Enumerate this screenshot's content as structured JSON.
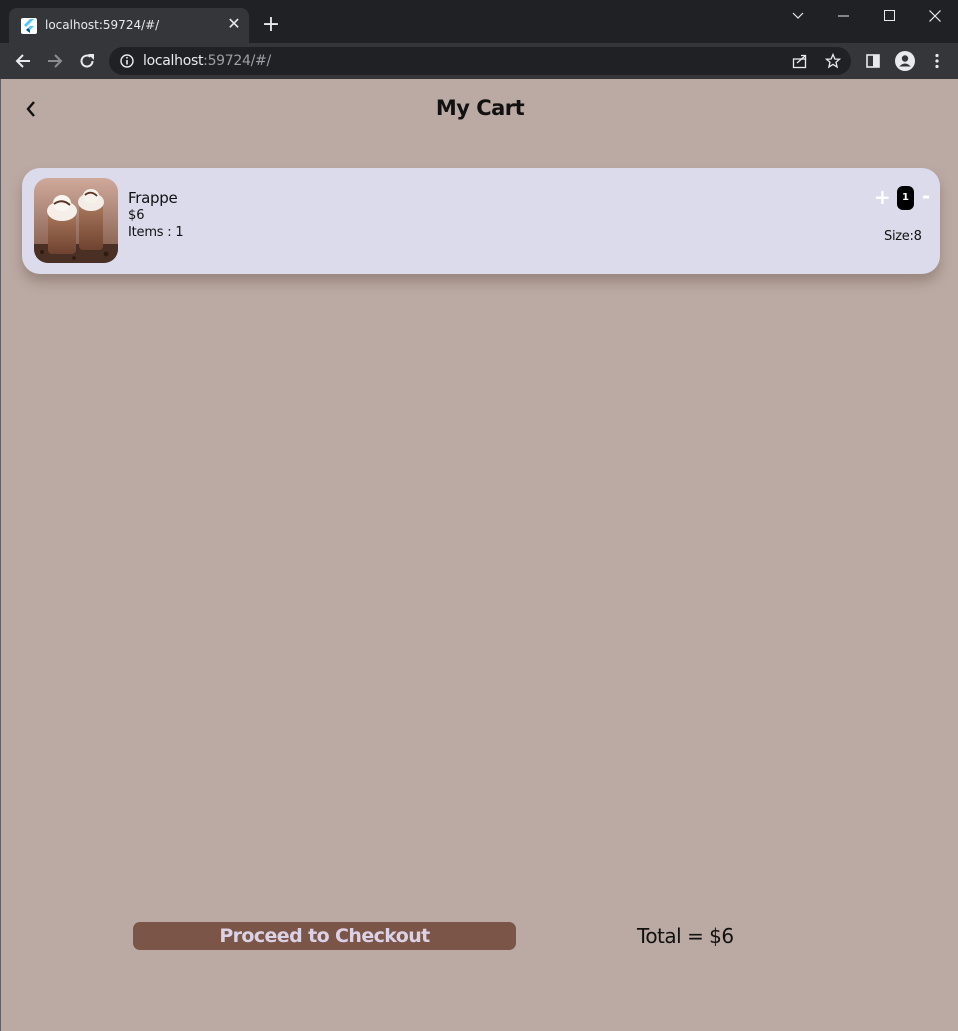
{
  "browser": {
    "tab_title": "localhost:59724/#/",
    "tab_close_glyph": "✕",
    "new_tab_glyph": "+",
    "url_host": "localhost",
    "url_rest": ":59724/#/",
    "icons": {
      "favicon": "flutter-icon",
      "back": "arrow-left-icon",
      "forward": "arrow-right-icon",
      "reload": "reload-icon",
      "site_info": "info-icon",
      "share": "share-icon",
      "bookmark": "star-icon",
      "side_panel": "side-panel-icon",
      "profile": "profile-icon",
      "menu": "kebab-menu-icon",
      "tab_search": "chevron-down-icon",
      "minimize": "minimize-icon",
      "maximize": "maximize-icon",
      "close": "close-icon"
    }
  },
  "app": {
    "title": "My Cart",
    "background_color": "#bbaaa3",
    "back_icon": "chevron-left-icon"
  },
  "cart": {
    "items": [
      {
        "name": "Frappe",
        "price": "$6",
        "items_label": "Items : 1",
        "quantity": "1",
        "plus_label": "+",
        "minus_label": "-",
        "size_label": "Size:8",
        "image": "frappe-photo",
        "card_color": "#dcdbec"
      }
    ]
  },
  "footer": {
    "checkout_label": "Proceed to Checkout",
    "checkout_color": "#7a5548",
    "total_label": "Total = $6"
  }
}
